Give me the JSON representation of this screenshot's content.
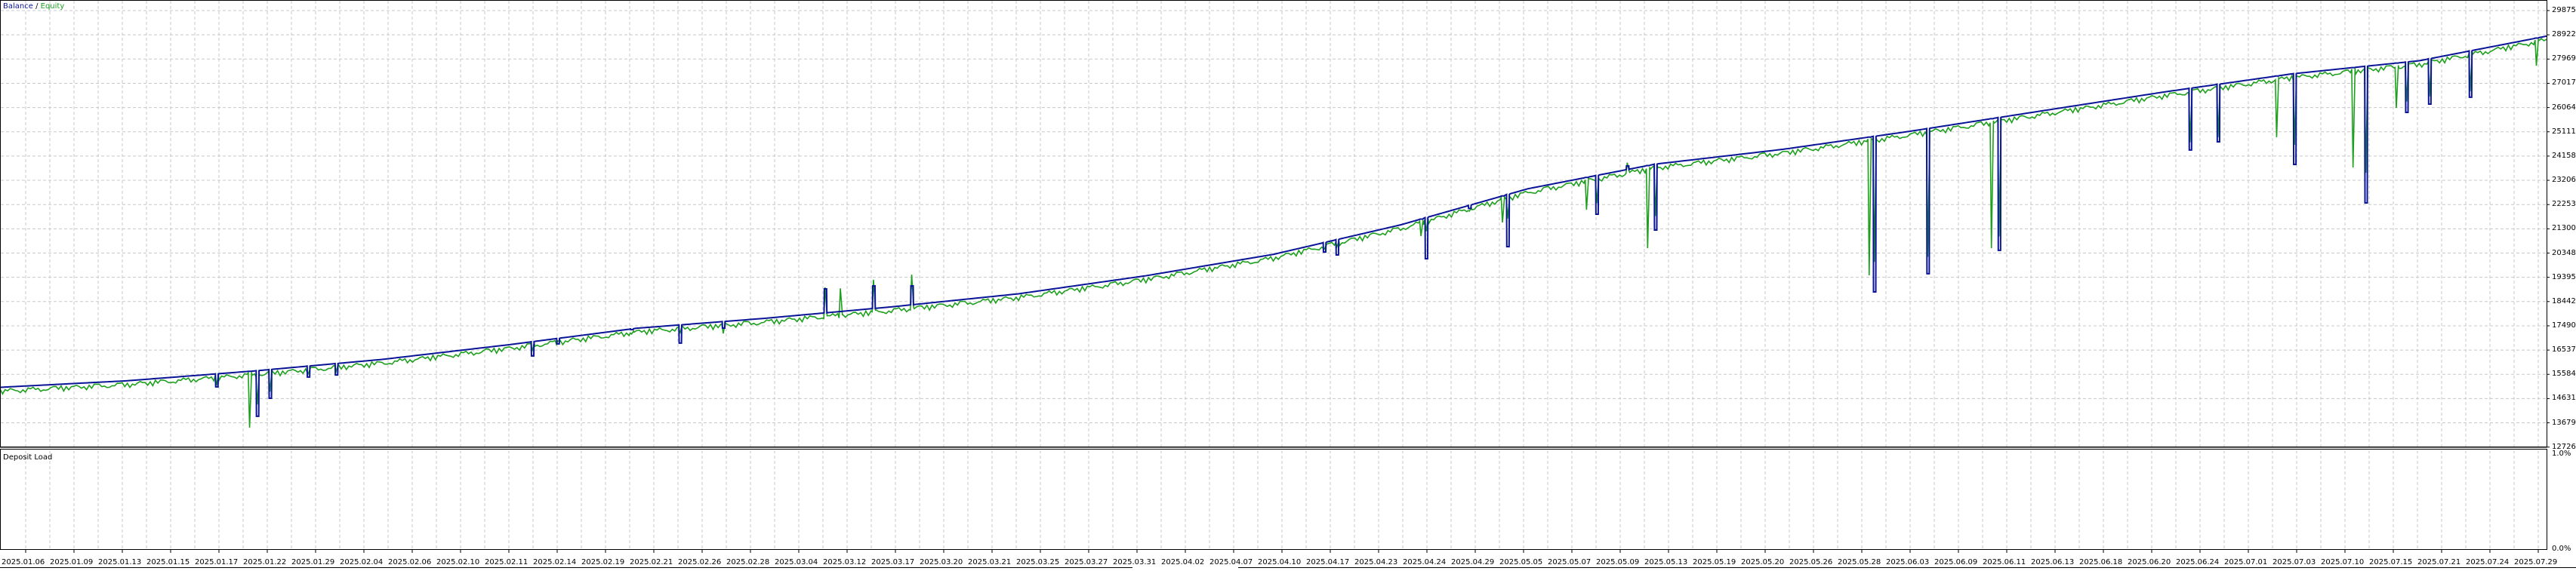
{
  "chart_data": {
    "type": "line",
    "title": "Balance / Equity",
    "legend": [
      {
        "name": "Balance",
        "color": "#0a1496"
      },
      {
        "name": "Equity",
        "color": "#1ea01e"
      }
    ],
    "legend_placement": "top-left",
    "legend_sep": "/",
    "x_unit": "trade index (0-1000 across test period)",
    "ylim": [
      12726,
      29875
    ],
    "y_ticks": [
      "29875",
      "28922",
      "27969",
      "27017",
      "26064",
      "25111",
      "24158",
      "23206",
      "22253",
      "21300",
      "20348",
      "19395",
      "18442",
      "17490",
      "16537",
      "15584",
      "14631",
      "13679",
      "12726"
    ],
    "x_ticks": [
      "2025.01.06",
      "2025.01.09",
      "2025.01.13",
      "2025.01.15",
      "2025.01.17",
      "2025.01.22",
      "2025.01.29",
      "2025.02.04",
      "2025.02.06",
      "2025.02.10",
      "2025.02.11",
      "2025.02.14",
      "2025.02.19",
      "2025.02.21",
      "2025.02.26",
      "2025.02.28",
      "2025.03.04",
      "2025.03.12",
      "2025.03.17",
      "2025.03.20",
      "2025.03.21",
      "2025.03.25",
      "2025.03.27",
      "2025.03.31",
      "2025.04.02",
      "2025.04.07",
      "2025.04.10",
      "2025.04.17",
      "2025.04.23",
      "2025.04.24",
      "2025.04.29",
      "2025.05.05",
      "2025.05.07",
      "2025.05.09",
      "2025.05.13",
      "2025.05.19",
      "2025.05.20",
      "2025.05.26",
      "2025.05.28",
      "2025.06.03",
      "2025.06.09",
      "2025.06.11",
      "2025.06.13",
      "2025.06.18",
      "2025.06.20",
      "2025.06.24",
      "2025.07.01",
      "2025.07.03",
      "2025.07.10",
      "2025.07.15",
      "2025.07.21",
      "2025.07.24",
      "2025.07.29"
    ],
    "grid": true,
    "balance_trend": [
      [
        0,
        15073
      ],
      [
        50,
        15331
      ],
      [
        100,
        15718
      ],
      [
        150,
        16169
      ],
      [
        200,
        16749
      ],
      [
        250,
        17394
      ],
      [
        300,
        17781
      ],
      [
        350,
        18233
      ],
      [
        400,
        18748
      ],
      [
        450,
        19457
      ],
      [
        500,
        20296
      ],
      [
        550,
        21456
      ],
      [
        600,
        22875
      ],
      [
        650,
        23842
      ],
      [
        700,
        24422
      ],
      [
        750,
        25132
      ],
      [
        800,
        25906
      ],
      [
        850,
        26679
      ],
      [
        900,
        27388
      ],
      [
        950,
        27904
      ],
      [
        1000,
        28870
      ]
    ],
    "drawdowns": [
      {
        "x": 85,
        "balance": 15090,
        "equity": 15150
      },
      {
        "x": 98,
        "balance": null,
        "equity": 13490
      },
      {
        "x": 101,
        "balance": 13935,
        "equity": 14400
      },
      {
        "x": 106,
        "balance": 14645,
        "equity": 14900
      },
      {
        "x": 121,
        "balance": 15475,
        "equity": 15600
      },
      {
        "x": 132,
        "balance": 15560,
        "equity": 15700
      },
      {
        "x": 209,
        "balance": 16305,
        "equity": 16500
      },
      {
        "x": 219,
        "balance": 16780,
        "equity": 16900
      },
      {
        "x": 248,
        "balance": 17340,
        "equity": 17165
      },
      {
        "x": 267,
        "balance": 16810,
        "equity": 17190
      },
      {
        "x": 284,
        "balance": 17400,
        "equity": 17190
      },
      {
        "x": 324,
        "balance": 18940,
        "equity": 19000
      },
      {
        "x": 330,
        "balance": null,
        "equity": 18960
      },
      {
        "x": 343,
        "balance": 19060,
        "equity": 19300
      },
      {
        "x": 358,
        "balance": 19060,
        "equity": 19500
      },
      {
        "x": 520,
        "balance": 20390,
        "equity": 20500
      },
      {
        "x": 525,
        "balance": 20275,
        "equity": 20600
      },
      {
        "x": 558,
        "balance": null,
        "equity": 21015
      },
      {
        "x": 560,
        "balance": 20125,
        "equity": 21200
      },
      {
        "x": 577,
        "balance": 22100,
        "equity": 21995
      },
      {
        "x": 590,
        "balance": null,
        "equity": 21550
      },
      {
        "x": 592,
        "balance": 20600,
        "equity": 21700
      },
      {
        "x": 623,
        "balance": null,
        "equity": 22050
      },
      {
        "x": 627,
        "balance": 21875,
        "equity": 22300
      },
      {
        "x": 639,
        "balance": 23770,
        "equity": 23900
      },
      {
        "x": 647,
        "balance": null,
        "equity": 20540
      },
      {
        "x": 650,
        "balance": 21250,
        "equity": 21800
      },
      {
        "x": 734,
        "balance": null,
        "equity": 19475
      },
      {
        "x": 736,
        "balance": 18820,
        "equity": 20000
      },
      {
        "x": 757,
        "balance": 19535,
        "equity": 20200
      },
      {
        "x": 782,
        "balance": null,
        "equity": 20540
      },
      {
        "x": 785,
        "balance": 20455,
        "equity": 21000
      },
      {
        "x": 860,
        "balance": 24395,
        "equity": 24700
      },
      {
        "x": 871,
        "balance": 24720,
        "equity": 24900
      },
      {
        "x": 894,
        "balance": null,
        "equity": 24900
      },
      {
        "x": 901,
        "balance": 23830,
        "equity": 24600
      },
      {
        "x": 924,
        "balance": null,
        "equity": 23710
      },
      {
        "x": 929,
        "balance": 22320,
        "equity": 23500
      },
      {
        "x": 941,
        "balance": null,
        "equity": 26050
      },
      {
        "x": 945,
        "balance": 25875,
        "equity": 26300
      },
      {
        "x": 954,
        "balance": 26200,
        "equity": 26500
      },
      {
        "x": 970,
        "balance": 26470,
        "equity": 26700
      },
      {
        "x": 996,
        "balance": null,
        "equity": 27710
      }
    ]
  },
  "deposit_load": {
    "title": "Deposit Load",
    "y_max_label": "1.0%",
    "y_min_label": "0.0%",
    "value_percent": 0
  }
}
